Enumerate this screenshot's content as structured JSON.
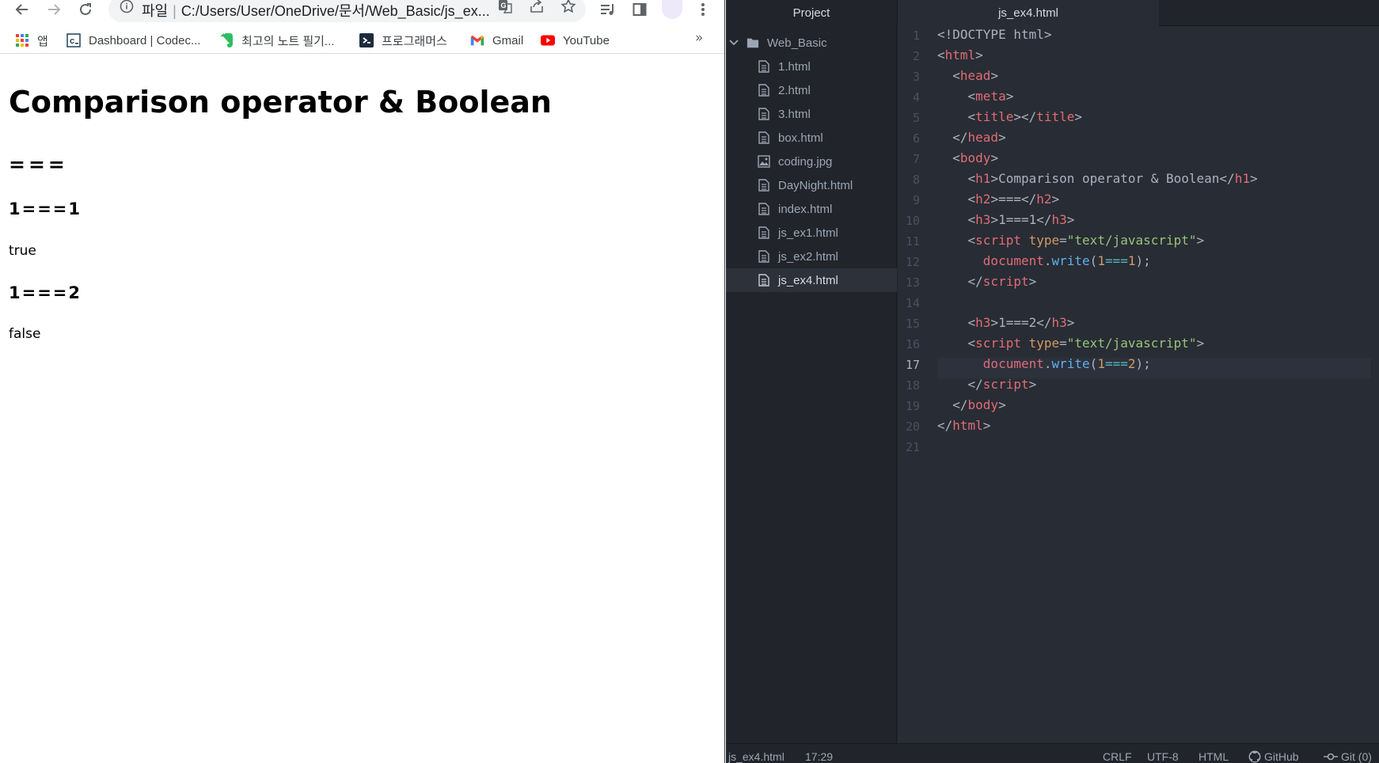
{
  "browser": {
    "omnibox": {
      "scheme_label": "파일",
      "url": "C:/Users/User/OneDrive/문서/Web_Basic/js_ex..."
    },
    "bookmarks": [
      {
        "label": "앱",
        "icon": "apps-grid-icon"
      },
      {
        "label": "Dashboard | Codec...",
        "icon": "codecademy-icon"
      },
      {
        "label": "최고의 노트 필기...",
        "icon": "evernote-icon"
      },
      {
        "label": "프로그래머스",
        "icon": "programmers-icon"
      },
      {
        "label": "Gmail",
        "icon": "gmail-icon"
      },
      {
        "label": "YouTube",
        "icon": "youtube-icon"
      }
    ],
    "more_label": "»",
    "page": {
      "h1": "Comparison operator & Boolean",
      "h2": "===",
      "sections": [
        {
          "heading": "1===1",
          "output": "true"
        },
        {
          "heading": "1===2",
          "output": "false"
        }
      ]
    }
  },
  "editor": {
    "tree_header": "Project",
    "active_tab": "js_ex4.html",
    "folder": "Web_Basic",
    "files": [
      {
        "name": "1.html",
        "type": "file"
      },
      {
        "name": "2.html",
        "type": "file"
      },
      {
        "name": "3.html",
        "type": "file"
      },
      {
        "name": "box.html",
        "type": "file"
      },
      {
        "name": "coding.jpg",
        "type": "image"
      },
      {
        "name": "DayNight.html",
        "type": "file"
      },
      {
        "name": "index.html",
        "type": "file"
      },
      {
        "name": "js_ex1.html",
        "type": "file"
      },
      {
        "name": "js_ex2.html",
        "type": "file"
      },
      {
        "name": "js_ex4.html",
        "type": "file",
        "selected": true
      }
    ],
    "line_numbers": [
      "1",
      "2",
      "3",
      "4",
      "5",
      "6",
      "7",
      "8",
      "9",
      "10",
      "11",
      "12",
      "13",
      "14",
      "15",
      "16",
      "17",
      "18",
      "19",
      "20",
      "21"
    ],
    "current_line": 17,
    "status": {
      "file": "js_ex4.html",
      "position": "17:29",
      "line_ending": "CRLF",
      "encoding": "UTF-8",
      "grammar": "HTML",
      "github": "GitHub",
      "git": "Git (0)"
    },
    "colors": {
      "tag": "#e06c75",
      "attr": "#d19a66",
      "string": "#98c379",
      "function": "#61afef",
      "operator": "#56b6c2"
    }
  }
}
